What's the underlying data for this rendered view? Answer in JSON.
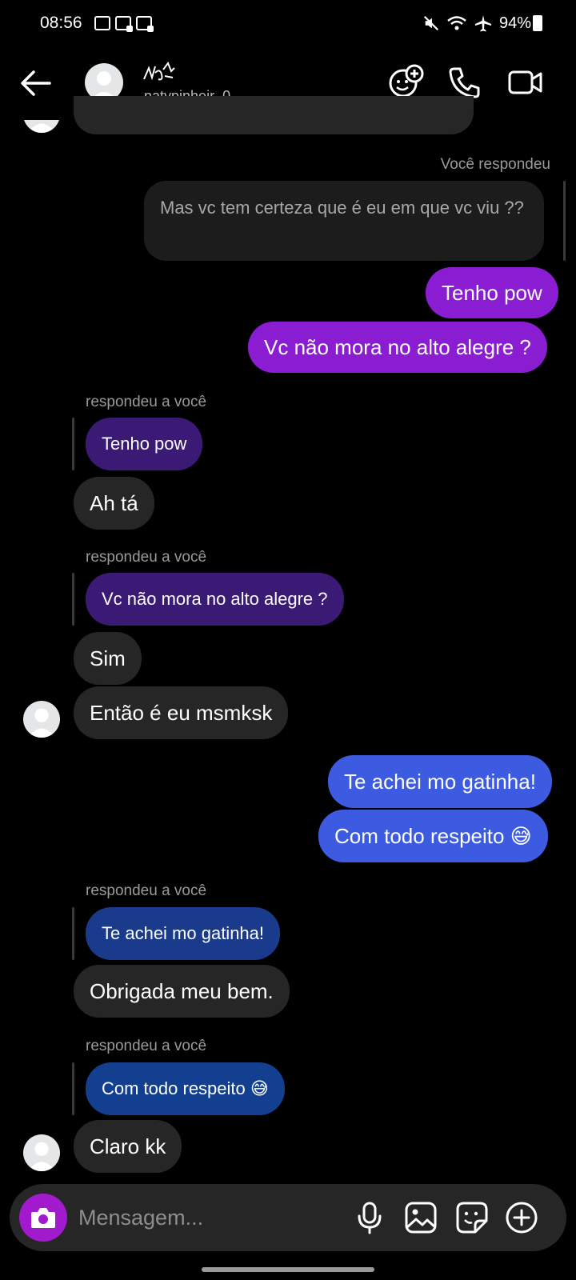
{
  "status_bar": {
    "time": "08:56",
    "battery": "94%"
  },
  "header": {
    "username": "natypinheir_0"
  },
  "messages": {
    "reply_sent_label": "Você respondeu",
    "quoted_sent": "Mas vc tem certeza que é eu em que vc viu ??",
    "sent_1": "Tenho pow",
    "sent_2": "Vc  não mora no alto alegre ?",
    "reply_label_1": "respondeu a você",
    "quote_1": "Tenho pow",
    "recv_1": "Ah tá",
    "reply_label_2": "respondeu a você",
    "quote_2": "Vc  não mora no alto alegre ?",
    "recv_2": "Sim",
    "recv_3": "Então é eu msmksk",
    "sent_3": "Te achei mo gatinha!",
    "sent_4": "Com todo respeito 😅",
    "reply_label_3": "respondeu a você",
    "quote_3": "Te achei mo gatinha!",
    "recv_4": "Obrigada meu bem.",
    "reply_label_4": "respondeu a você",
    "quote_4": "Com todo respeito 😅",
    "recv_5": "Claro kk"
  },
  "composer": {
    "placeholder": "Mensagem..."
  },
  "icons": {
    "back": "arrow-left-icon",
    "effects": "effects-icon",
    "call": "phone-icon",
    "video": "video-camera-icon",
    "camera": "camera-icon",
    "mic": "microphone-icon",
    "gallery": "image-icon",
    "sticker": "sticker-icon",
    "add": "plus-circle-icon"
  },
  "colors": {
    "sent_purple": "#8a1cd1",
    "sent_blue": "#3d5be0",
    "received": "#262626",
    "camera_button": "#a11acd"
  }
}
